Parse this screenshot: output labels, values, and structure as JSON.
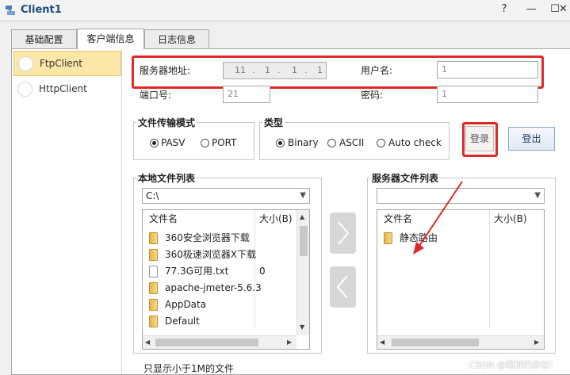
{
  "window": {
    "title": "Client1",
    "controls": [
      "?",
      "—",
      "☐",
      "✕"
    ]
  },
  "tabs": [
    {
      "label": "基础配置",
      "active": false
    },
    {
      "label": "客户端信息",
      "active": true
    },
    {
      "label": "日志信息",
      "active": false
    }
  ],
  "sidebar": {
    "items": [
      {
        "label": "FtpClient",
        "selected": true
      },
      {
        "label": "HttpClient",
        "selected": false
      }
    ]
  },
  "form": {
    "server_label": "服务器地址:",
    "server_ip": [
      "11",
      "1",
      "1",
      "1"
    ],
    "ip_sep": ".",
    "user_label": "用户名:",
    "user_value": "1",
    "port_label": "端口号:",
    "port_value": "21",
    "password_label": "密码:",
    "password_value": "1"
  },
  "transfer_mode": {
    "title": "文件传输模式",
    "options": [
      "PASV",
      "PORT"
    ],
    "selected": "PASV"
  },
  "type_group": {
    "title": "类型",
    "options": [
      "Binary",
      "ASCII",
      "Auto check"
    ],
    "selected": "Binary"
  },
  "buttons": {
    "login": "登录",
    "logout": "登出",
    "upload_arrow": "›",
    "download_arrow": "‹"
  },
  "local": {
    "title": "本地文件列表",
    "path": "C:\\",
    "columns": [
      "文件名",
      "大小(B)"
    ],
    "files": [
      {
        "name": "360安全浏览器下载",
        "size": "",
        "type": "folder"
      },
      {
        "name": "360极速浏览器X下载",
        "size": "",
        "type": "folder"
      },
      {
        "name": "77.3G可用.txt",
        "size": "0",
        "type": "file"
      },
      {
        "name": "apache-jmeter-5.6.3",
        "size": "",
        "type": "folder"
      },
      {
        "name": "AppData",
        "size": "",
        "type": "folder"
      },
      {
        "name": "Default",
        "size": "",
        "type": "folder"
      }
    ]
  },
  "remote": {
    "title": "服务器文件列表",
    "path": "",
    "columns": [
      "文件名",
      "大小(B)"
    ],
    "files": [
      {
        "name": "静态路由",
        "size": "",
        "type": "folder"
      }
    ]
  },
  "footer": {
    "filter_label": "只显示小于1M的文件"
  },
  "watermark": "CSDN @昵称已存在!",
  "colors": {
    "highlight_red": "#e02828",
    "selected_item": "#fce7a8",
    "title_blue": "#1c4a7a"
  }
}
